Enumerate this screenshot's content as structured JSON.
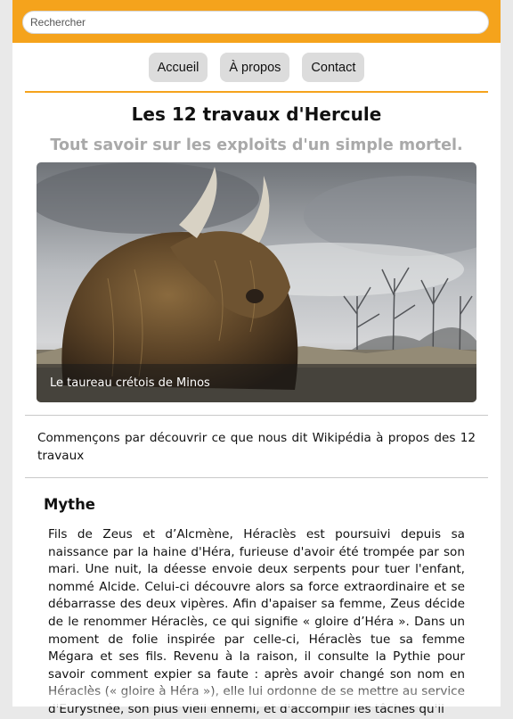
{
  "search": {
    "placeholder": "Rechercher"
  },
  "nav": {
    "items": [
      "Accueil",
      "À propos",
      "Contact"
    ]
  },
  "header": {
    "title": "Les 12 travaux d'Hercule",
    "subtitle": "Tout savoir sur les exploits d'un simple mortel."
  },
  "hero": {
    "caption": "Le taureau crétois de Minos"
  },
  "intro": {
    "text": "Commençons par découvrir ce que nous dit Wikipédia à propos des 12 travaux"
  },
  "section": {
    "heading": "Mythe",
    "paragraph": "Fils de Zeus et d’Alcmène, Héraclès est poursuivi depuis sa naissance par la haine d'Héra, furieuse d'avoir été trompée par son mari. Une nuit, la déesse envoie deux serpents pour tuer l'enfant, nommé Alcide. Celui-ci découvre alors sa force extraordinaire et se débarrasse des deux vipères. Afin d'apaiser sa femme, Zeus décide de le renommer Héraclès, ce qui signifie « gloire d’Héra ». Dans un moment de folie inspirée par celle-ci, Héraclès tue sa femme Mégara et ses fils. Revenu à la raison, il consulte la Pythie pour savoir comment expier sa faute : après avoir changé son nom en Héraclès (« gloire à Héra »), elle lui ordonne de se mettre au service d'Eurysthée, son plus vieil ennemi, et d'accomplir les tâches qu'il"
  },
  "colors": {
    "accent": "#f5a31c",
    "nav_bg": "#dcdcdc",
    "subtitle": "#a9a9a9"
  }
}
